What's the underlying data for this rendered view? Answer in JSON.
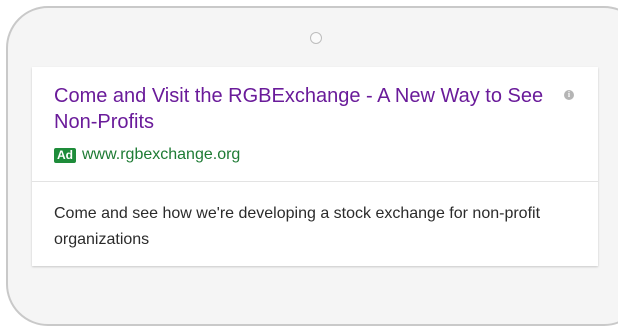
{
  "ad": {
    "headline": "Come and Visit the RGBExchange - A New Way to See Non-Profits",
    "badge": "Ad",
    "display_url": "www.rgbexchange.org",
    "description": "Come and see how we're developing a stock exchange for non-profit organizations",
    "info_icon": "info-icon",
    "info_icon_glyph": "i"
  },
  "colors": {
    "headline": "#6a1b9a",
    "badge_bg": "#1e8c3a",
    "display_url": "#1e7b34"
  }
}
